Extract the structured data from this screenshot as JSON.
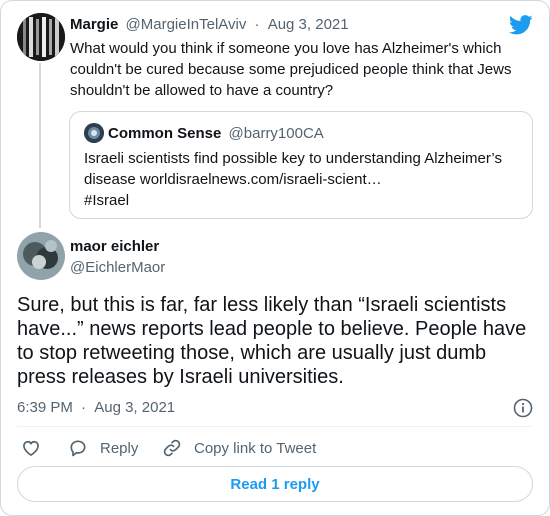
{
  "parent_tweet": {
    "author_name": "Margie",
    "author_handle": "@MargieInTelAviv",
    "separator": "·",
    "date": "Aug 3, 2021",
    "text_lines": [
      "What would you think if someone you love has Alzheimer's which",
      "couldn't be cured because some prejudiced people think that Jews",
      "shouldn't be allowed to have a country?"
    ]
  },
  "quoted_tweet": {
    "author_name": "Common Sense",
    "author_handle": "@barry100CA",
    "text_lines": [
      "Israeli scientists find possible key to understanding Alzheimer’s",
      "disease worldisraelnews.com/israeli-scient…",
      "#Israel"
    ]
  },
  "main_tweet": {
    "author_name": "maor eichler",
    "author_handle": "@EichlerMaor",
    "text_lines": [
      "Sure, but this is far, far less likely than “Israeli scientists",
      "have...” news reports lead people to believe. People have",
      "to stop retweeting those, which are usually just dumb",
      "press releases by Israeli universities."
    ],
    "time": "6:39 PM",
    "separator": "·",
    "date": "Aug 3, 2021"
  },
  "actions": {
    "reply_label": "Reply",
    "copy_link_label": "Copy link to Tweet"
  },
  "read_replies_label": "Read 1 reply",
  "colors": {
    "twitter_blue": "#1d9bf0",
    "muted_text": "#536471",
    "border": "#cfd9de"
  },
  "icons": [
    "twitter-bird-icon",
    "info-icon",
    "heart-icon",
    "reply-icon",
    "link-icon"
  ]
}
